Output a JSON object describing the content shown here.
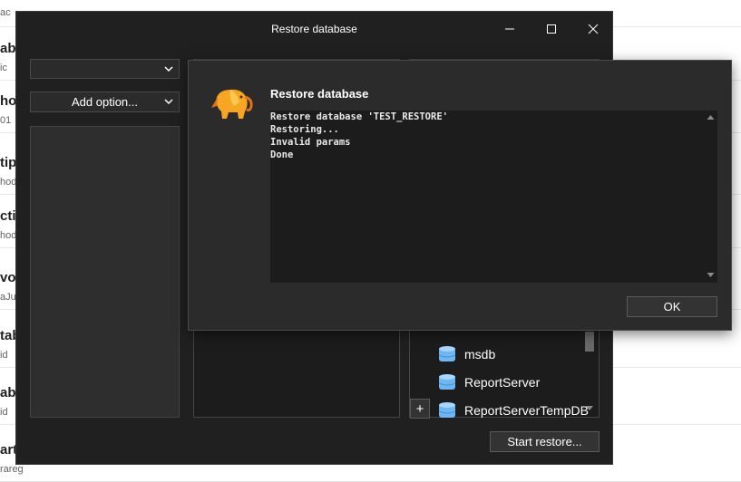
{
  "background_list": {
    "items": [
      {
        "title": "",
        "sub": "ac"
      },
      {
        "title": "ab",
        "sub": "ic"
      },
      {
        "title": "hot",
        "sub": "01"
      },
      {
        "title": "tipl",
        "sub": "hod"
      },
      {
        "title": "ctic",
        "sub": "hod"
      },
      {
        "title": "vor",
        "sub": "aJu"
      },
      {
        "title": "tab",
        "sub": "id"
      },
      {
        "title": "ab",
        "sub": "id"
      },
      {
        "title": "art",
        "sub": "rareg"
      }
    ]
  },
  "window": {
    "title": "Restore database",
    "controls": {
      "minimize": "minimize-icon",
      "maximize": "maximize-icon",
      "close": "close-icon"
    },
    "source_select": {
      "value": ""
    },
    "add_option_select": {
      "value": "Add option..."
    },
    "databases": [
      {
        "name": "msdb",
        "icon": "database-icon"
      },
      {
        "name": "ReportServer",
        "icon": "database-icon"
      },
      {
        "name": "ReportServerTempDB",
        "icon": "database-icon"
      }
    ],
    "add_button_label": "+",
    "start_restore_label": "Start restore..."
  },
  "dialog": {
    "logo": "elephant-logo",
    "title": "Restore database",
    "log_lines": [
      "Restore database 'TEST_RESTORE'",
      "Restoring...",
      "Invalid params",
      "Done"
    ],
    "ok_label": "OK"
  },
  "colors": {
    "window_bg": "#202020",
    "dialog_bg": "#2b2b2b",
    "log_bg": "#1c1c1c",
    "db_icon": "#6fb6f5"
  }
}
